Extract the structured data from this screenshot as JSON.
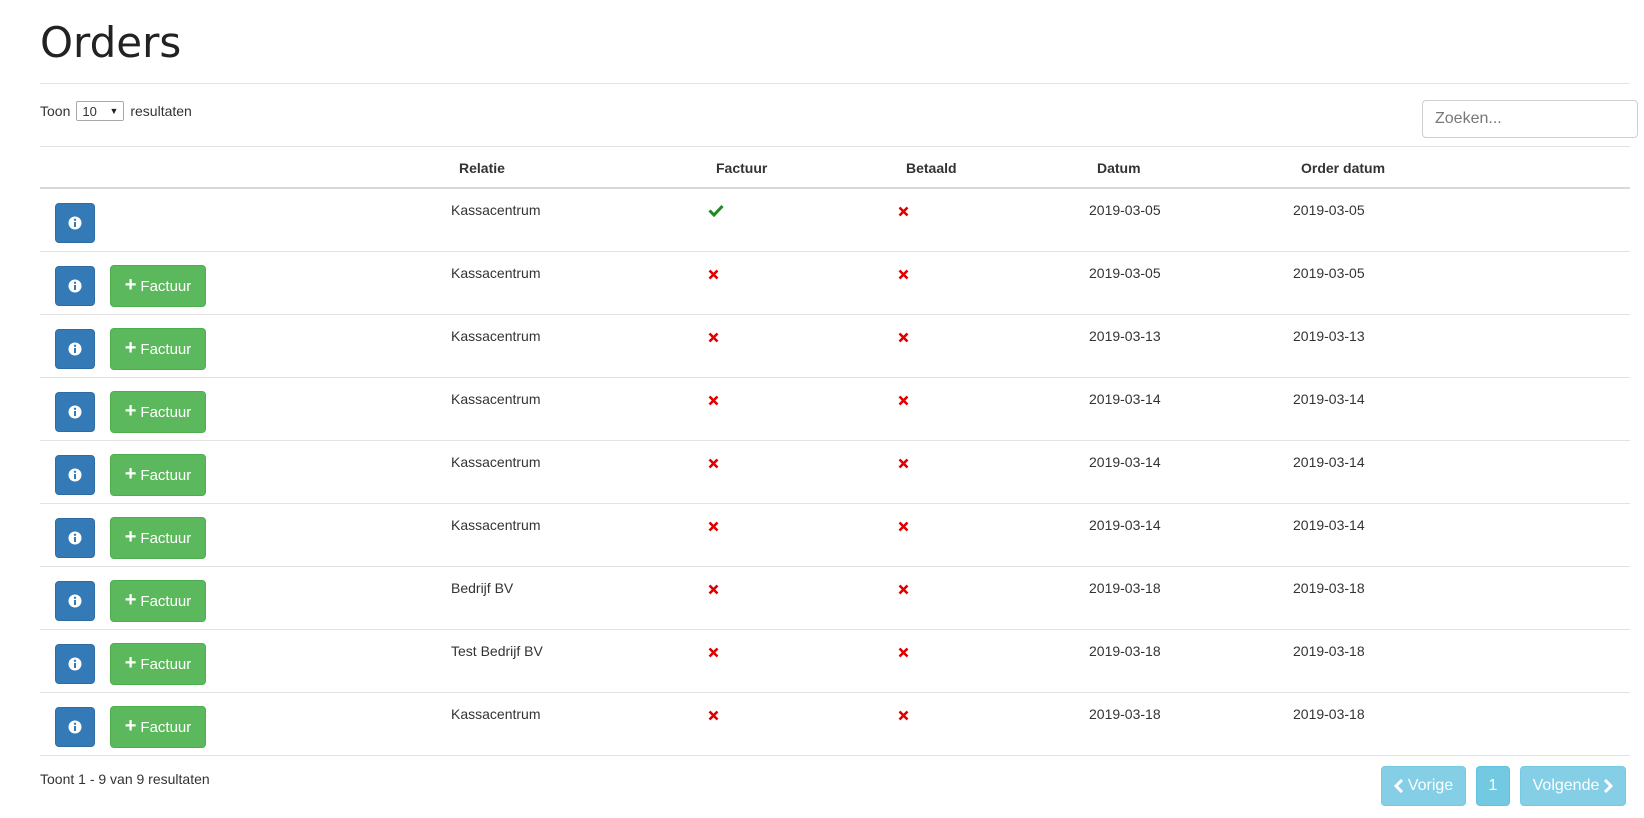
{
  "page": {
    "title": "Orders"
  },
  "controls": {
    "show_prefix": "Toon",
    "show_value": "10",
    "show_suffix": "resultaten",
    "search_placeholder": "Zoeken..."
  },
  "table": {
    "headers": {
      "relatie": "Relatie",
      "factuur": "Factuur",
      "betaald": "Betaald",
      "datum": "Datum",
      "order_datum": "Order datum"
    },
    "factuur_button_label": "Factuur",
    "rows": [
      {
        "relatie": "Kassacentrum",
        "factuur": true,
        "betaald": false,
        "datum": "2019-03-05",
        "order_datum": "2019-03-05",
        "show_factuur_button": false
      },
      {
        "relatie": "Kassacentrum",
        "factuur": false,
        "betaald": false,
        "datum": "2019-03-05",
        "order_datum": "2019-03-05",
        "show_factuur_button": true
      },
      {
        "relatie": "Kassacentrum",
        "factuur": false,
        "betaald": false,
        "datum": "2019-03-13",
        "order_datum": "2019-03-13",
        "show_factuur_button": true
      },
      {
        "relatie": "Kassacentrum",
        "factuur": false,
        "betaald": false,
        "datum": "2019-03-14",
        "order_datum": "2019-03-14",
        "show_factuur_button": true
      },
      {
        "relatie": "Kassacentrum",
        "factuur": false,
        "betaald": false,
        "datum": "2019-03-14",
        "order_datum": "2019-03-14",
        "show_factuur_button": true
      },
      {
        "relatie": "Kassacentrum",
        "factuur": false,
        "betaald": false,
        "datum": "2019-03-14",
        "order_datum": "2019-03-14",
        "show_factuur_button": true
      },
      {
        "relatie": "Bedrijf BV",
        "factuur": false,
        "betaald": false,
        "datum": "2019-03-18",
        "order_datum": "2019-03-18",
        "show_factuur_button": true
      },
      {
        "relatie": "Test Bedrijf BV",
        "factuur": false,
        "betaald": false,
        "datum": "2019-03-18",
        "order_datum": "2019-03-18",
        "show_factuur_button": true
      },
      {
        "relatie": "Kassacentrum",
        "factuur": false,
        "betaald": false,
        "datum": "2019-03-18",
        "order_datum": "2019-03-18",
        "show_factuur_button": true
      }
    ]
  },
  "footer": {
    "summary": "Toont 1 - 9 van 9 resultaten",
    "prev_label": "Vorige",
    "page_number": "1",
    "next_label": "Volgende"
  },
  "icons": {
    "info": "info-circle-icon",
    "plus": "plus-icon",
    "check": "check-icon",
    "cross": "cross-icon",
    "chevron_left": "chevron-left-icon",
    "chevron_right": "chevron-right-icon"
  },
  "colors": {
    "primary": "#337ab7",
    "success": "#5cb85c",
    "info": "#5bc0de",
    "cross": "#e00000",
    "check": "#1e8a1e"
  }
}
